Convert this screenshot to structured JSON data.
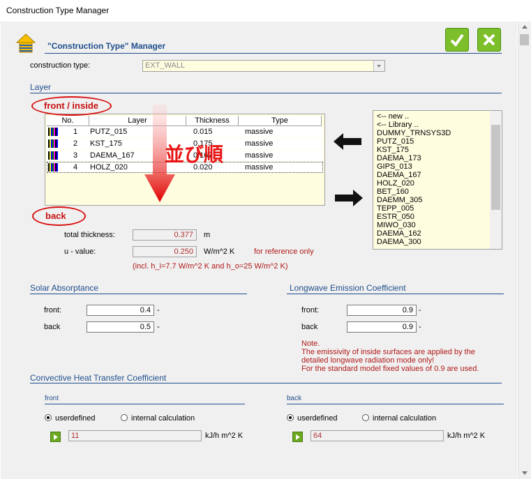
{
  "window": {
    "title": "Construction Type Manager"
  },
  "header": {
    "title": "\"Construction Type\" Manager"
  },
  "construction_type": {
    "label": "construction type:",
    "value": "EXT_WALL"
  },
  "layer": {
    "section_title": "Layer",
    "front_label": "front / inside",
    "back_label": "back",
    "sort_annotation": "並び順",
    "columns": [
      "No.",
      "Layer",
      "Thickness",
      "Type"
    ],
    "rows": [
      {
        "no": "1",
        "layer": "PUTZ_015",
        "thickness": "0.015",
        "type": "massive"
      },
      {
        "no": "2",
        "layer": "KST_175",
        "thickness": "0.175",
        "type": "massive"
      },
      {
        "no": "3",
        "layer": "DAEMA_167",
        "thickness": "0.167",
        "type": "massive"
      },
      {
        "no": "4",
        "layer": "HOLZ_020",
        "thickness": "0.020",
        "type": "massive"
      }
    ],
    "library": [
      "<-- new ..",
      "<-- Library ..",
      "DUMMY_TRNSYS3D",
      "PUTZ_015",
      "KST_175",
      "DAEMA_173",
      "GIPS_013",
      "DAEMA_167",
      "HOLZ_020",
      "BET_160",
      "DAEMM_305",
      "TEPP_005",
      "ESTR_050",
      "MIWO_030",
      "DAEMA_162",
      "DAEMA_300"
    ],
    "total_thickness": {
      "label": "total thickness:",
      "value": "0.377",
      "unit": "m"
    },
    "u_value": {
      "label": "u - value:",
      "value": "0.250",
      "unit": "W/m^2 K",
      "note": "for reference only"
    },
    "incl_note": "(incl. h_i=7.7 W/m^2 K and h_o=25 W/m^2 K)"
  },
  "solar": {
    "section_title": "Solar Absorptance",
    "front_label": "front:",
    "front_value": "0.4",
    "back_label": "back",
    "back_value": "0.5",
    "dash": "-"
  },
  "longwave": {
    "section_title": "Longwave Emission Coefficient",
    "front_label": "front:",
    "front_value": "0.9",
    "back_label": "back",
    "back_value": "0.9",
    "note_lines": [
      "Note.",
      "The emissivity of inside surfaces are applied by the",
      "detailed longwave radiation mode only!",
      "For the standard model fixed values of 0.9 are used."
    ]
  },
  "convective": {
    "section_title": "Convective Heat Transfer Coefficient",
    "front": {
      "title": "front",
      "opt1": "userdefined",
      "opt2": "internal calculation",
      "value": "11",
      "unit": "kJ/h m^2 K"
    },
    "back": {
      "title": "back",
      "opt1": "userdefined",
      "opt2": "internal calculation",
      "value": "64",
      "unit": "kJ/h m^2 K"
    }
  },
  "colors": {
    "accent": "#1f4e8c",
    "ok": "#7cbf2a",
    "alert": "#b01818"
  }
}
